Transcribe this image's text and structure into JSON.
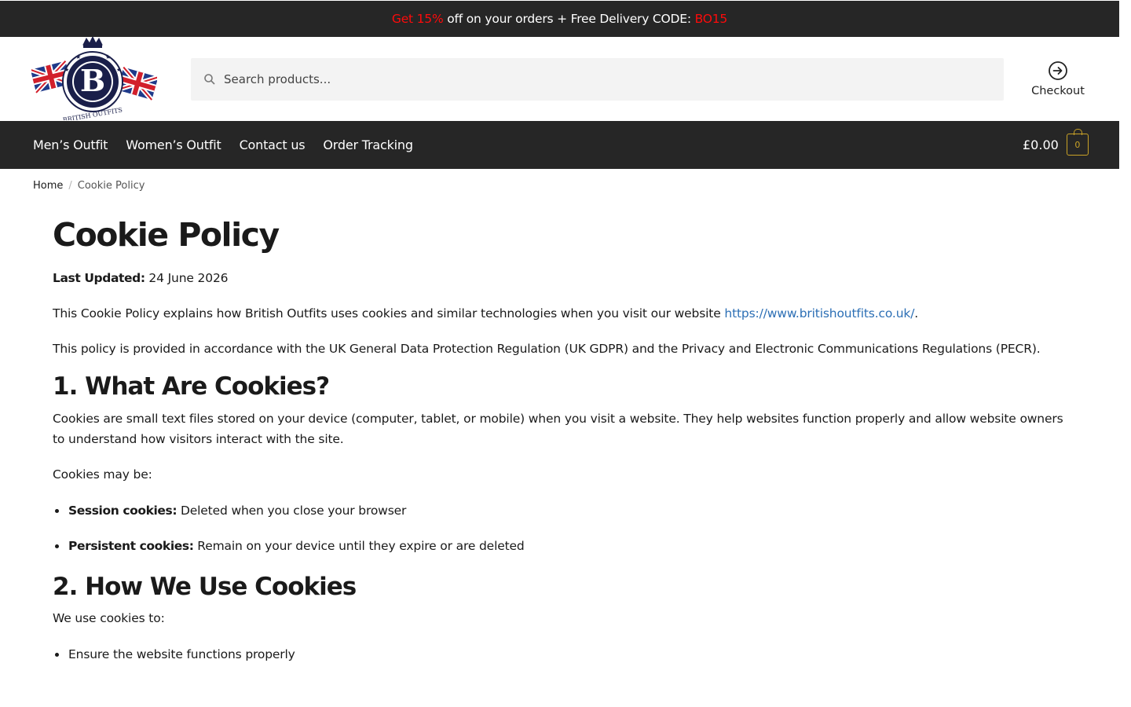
{
  "promo": {
    "part1": "Get 15%",
    "part2": " off on your orders + Free Delivery CODE: ",
    "code": "BO15"
  },
  "header": {
    "logo_text": "BRITISH OUTFITS",
    "logo_letter": "B",
    "search_placeholder": "Search products...",
    "checkout_label": "Checkout"
  },
  "nav": {
    "items": [
      "Men’s Outfit",
      "Women’s Outfit",
      "Contact us",
      "Order Tracking"
    ],
    "cart_total": "£0.00",
    "cart_count": "0"
  },
  "breadcrumb": {
    "home": "Home",
    "separator": "/",
    "current": "Cookie Policy"
  },
  "content": {
    "title": "Cookie Policy",
    "updated_label": "Last Updated:",
    "updated_value": " 24 June 2026",
    "intro_text": "This Cookie Policy explains how British Outfits uses cookies and similar technologies when you visit our website ",
    "intro_link": "https://www.britishoutfits.co.uk/",
    "intro_end": ".",
    "compliance": "This policy is provided in accordance with the UK General Data Protection Regulation (UK GDPR) and the Privacy and Electronic Communications Regulations (PECR).",
    "section1_title": "1. What Are Cookies?",
    "section1_text": "Cookies are small text files stored on your device (computer, tablet, or mobile) when you visit a website. They help websites function properly and allow website owners to understand how visitors interact with the site.",
    "may_be": "Cookies may be:",
    "types": [
      {
        "label": "Session cookies:",
        "text": " Deleted when you close your browser"
      },
      {
        "label": "Persistent cookies:",
        "text": " Remain on your device until they expire or are deleted"
      }
    ],
    "section2_title": "2. How We Use Cookies",
    "use_intro": "We use cookies to:",
    "uses": [
      "Ensure the website functions properly"
    ]
  },
  "colors": {
    "promo_bg": "#262626",
    "promo_highlight": "#ff0a0a",
    "nav_bg": "#262626",
    "cart_accent": "#c9a227",
    "link": "#2c6fb5"
  }
}
